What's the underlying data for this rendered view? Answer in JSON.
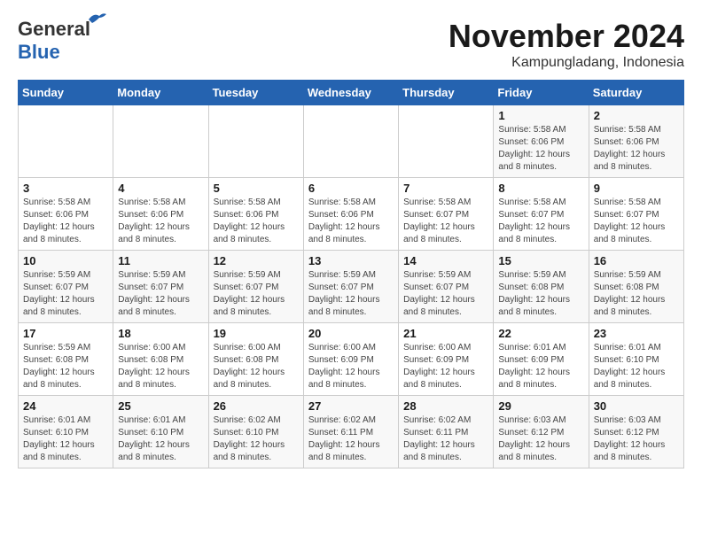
{
  "header": {
    "logo_general": "General",
    "logo_blue": "Blue",
    "month": "November 2024",
    "location": "Kampungladang, Indonesia"
  },
  "weekdays": [
    "Sunday",
    "Monday",
    "Tuesday",
    "Wednesday",
    "Thursday",
    "Friday",
    "Saturday"
  ],
  "weeks": [
    [
      {
        "day": "",
        "sunrise": "",
        "sunset": "",
        "daylight": ""
      },
      {
        "day": "",
        "sunrise": "",
        "sunset": "",
        "daylight": ""
      },
      {
        "day": "",
        "sunrise": "",
        "sunset": "",
        "daylight": ""
      },
      {
        "day": "",
        "sunrise": "",
        "sunset": "",
        "daylight": ""
      },
      {
        "day": "",
        "sunrise": "",
        "sunset": "",
        "daylight": ""
      },
      {
        "day": "1",
        "sunrise": "Sunrise: 5:58 AM",
        "sunset": "Sunset: 6:06 PM",
        "daylight": "Daylight: 12 hours and 8 minutes."
      },
      {
        "day": "2",
        "sunrise": "Sunrise: 5:58 AM",
        "sunset": "Sunset: 6:06 PM",
        "daylight": "Daylight: 12 hours and 8 minutes."
      }
    ],
    [
      {
        "day": "3",
        "sunrise": "Sunrise: 5:58 AM",
        "sunset": "Sunset: 6:06 PM",
        "daylight": "Daylight: 12 hours and 8 minutes."
      },
      {
        "day": "4",
        "sunrise": "Sunrise: 5:58 AM",
        "sunset": "Sunset: 6:06 PM",
        "daylight": "Daylight: 12 hours and 8 minutes."
      },
      {
        "day": "5",
        "sunrise": "Sunrise: 5:58 AM",
        "sunset": "Sunset: 6:06 PM",
        "daylight": "Daylight: 12 hours and 8 minutes."
      },
      {
        "day": "6",
        "sunrise": "Sunrise: 5:58 AM",
        "sunset": "Sunset: 6:06 PM",
        "daylight": "Daylight: 12 hours and 8 minutes."
      },
      {
        "day": "7",
        "sunrise": "Sunrise: 5:58 AM",
        "sunset": "Sunset: 6:07 PM",
        "daylight": "Daylight: 12 hours and 8 minutes."
      },
      {
        "day": "8",
        "sunrise": "Sunrise: 5:58 AM",
        "sunset": "Sunset: 6:07 PM",
        "daylight": "Daylight: 12 hours and 8 minutes."
      },
      {
        "day": "9",
        "sunrise": "Sunrise: 5:58 AM",
        "sunset": "Sunset: 6:07 PM",
        "daylight": "Daylight: 12 hours and 8 minutes."
      }
    ],
    [
      {
        "day": "10",
        "sunrise": "Sunrise: 5:59 AM",
        "sunset": "Sunset: 6:07 PM",
        "daylight": "Daylight: 12 hours and 8 minutes."
      },
      {
        "day": "11",
        "sunrise": "Sunrise: 5:59 AM",
        "sunset": "Sunset: 6:07 PM",
        "daylight": "Daylight: 12 hours and 8 minutes."
      },
      {
        "day": "12",
        "sunrise": "Sunrise: 5:59 AM",
        "sunset": "Sunset: 6:07 PM",
        "daylight": "Daylight: 12 hours and 8 minutes."
      },
      {
        "day": "13",
        "sunrise": "Sunrise: 5:59 AM",
        "sunset": "Sunset: 6:07 PM",
        "daylight": "Daylight: 12 hours and 8 minutes."
      },
      {
        "day": "14",
        "sunrise": "Sunrise: 5:59 AM",
        "sunset": "Sunset: 6:07 PM",
        "daylight": "Daylight: 12 hours and 8 minutes."
      },
      {
        "day": "15",
        "sunrise": "Sunrise: 5:59 AM",
        "sunset": "Sunset: 6:08 PM",
        "daylight": "Daylight: 12 hours and 8 minutes."
      },
      {
        "day": "16",
        "sunrise": "Sunrise: 5:59 AM",
        "sunset": "Sunset: 6:08 PM",
        "daylight": "Daylight: 12 hours and 8 minutes."
      }
    ],
    [
      {
        "day": "17",
        "sunrise": "Sunrise: 5:59 AM",
        "sunset": "Sunset: 6:08 PM",
        "daylight": "Daylight: 12 hours and 8 minutes."
      },
      {
        "day": "18",
        "sunrise": "Sunrise: 6:00 AM",
        "sunset": "Sunset: 6:08 PM",
        "daylight": "Daylight: 12 hours and 8 minutes."
      },
      {
        "day": "19",
        "sunrise": "Sunrise: 6:00 AM",
        "sunset": "Sunset: 6:08 PM",
        "daylight": "Daylight: 12 hours and 8 minutes."
      },
      {
        "day": "20",
        "sunrise": "Sunrise: 6:00 AM",
        "sunset": "Sunset: 6:09 PM",
        "daylight": "Daylight: 12 hours and 8 minutes."
      },
      {
        "day": "21",
        "sunrise": "Sunrise: 6:00 AM",
        "sunset": "Sunset: 6:09 PM",
        "daylight": "Daylight: 12 hours and 8 minutes."
      },
      {
        "day": "22",
        "sunrise": "Sunrise: 6:01 AM",
        "sunset": "Sunset: 6:09 PM",
        "daylight": "Daylight: 12 hours and 8 minutes."
      },
      {
        "day": "23",
        "sunrise": "Sunrise: 6:01 AM",
        "sunset": "Sunset: 6:10 PM",
        "daylight": "Daylight: 12 hours and 8 minutes."
      }
    ],
    [
      {
        "day": "24",
        "sunrise": "Sunrise: 6:01 AM",
        "sunset": "Sunset: 6:10 PM",
        "daylight": "Daylight: 12 hours and 8 minutes."
      },
      {
        "day": "25",
        "sunrise": "Sunrise: 6:01 AM",
        "sunset": "Sunset: 6:10 PM",
        "daylight": "Daylight: 12 hours and 8 minutes."
      },
      {
        "day": "26",
        "sunrise": "Sunrise: 6:02 AM",
        "sunset": "Sunset: 6:10 PM",
        "daylight": "Daylight: 12 hours and 8 minutes."
      },
      {
        "day": "27",
        "sunrise": "Sunrise: 6:02 AM",
        "sunset": "Sunset: 6:11 PM",
        "daylight": "Daylight: 12 hours and 8 minutes."
      },
      {
        "day": "28",
        "sunrise": "Sunrise: 6:02 AM",
        "sunset": "Sunset: 6:11 PM",
        "daylight": "Daylight: 12 hours and 8 minutes."
      },
      {
        "day": "29",
        "sunrise": "Sunrise: 6:03 AM",
        "sunset": "Sunset: 6:12 PM",
        "daylight": "Daylight: 12 hours and 8 minutes."
      },
      {
        "day": "30",
        "sunrise": "Sunrise: 6:03 AM",
        "sunset": "Sunset: 6:12 PM",
        "daylight": "Daylight: 12 hours and 8 minutes."
      }
    ]
  ]
}
